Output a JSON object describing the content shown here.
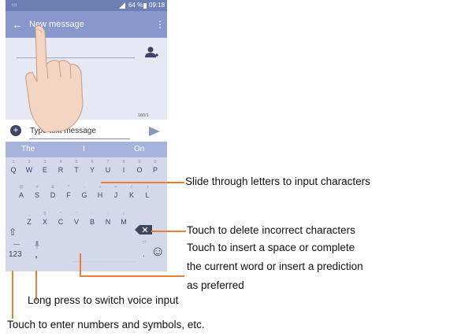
{
  "status_bar": {
    "left": "▭",
    "battery": "64 %",
    "time": "09:18"
  },
  "app_bar": {
    "back": "←",
    "title": "New message",
    "more": "⋮"
  },
  "compose": {
    "counter": "160/1",
    "plus": "+",
    "placeholder": "Type text message"
  },
  "suggestions": [
    "The",
    "I",
    "On"
  ],
  "keyboard": {
    "row1": [
      {
        "main": "Q",
        "sub": "1"
      },
      {
        "main": "W",
        "sub": "2"
      },
      {
        "main": "E",
        "sub": "3"
      },
      {
        "main": "R",
        "sub": "4"
      },
      {
        "main": "T",
        "sub": "5"
      },
      {
        "main": "Y",
        "sub": "6"
      },
      {
        "main": "U",
        "sub": "7"
      },
      {
        "main": "I",
        "sub": "8"
      },
      {
        "main": "O",
        "sub": "9"
      },
      {
        "main": "P",
        "sub": "0"
      }
    ],
    "row2": [
      {
        "main": "A",
        "sub": "@"
      },
      {
        "main": "S",
        "sub": "#"
      },
      {
        "main": "D",
        "sub": "&"
      },
      {
        "main": "F",
        "sub": "*"
      },
      {
        "main": "G",
        "sub": "-"
      },
      {
        "main": "H",
        "sub": "+"
      },
      {
        "main": "J",
        "sub": "="
      },
      {
        "main": "K",
        "sub": "("
      },
      {
        "main": "L",
        "sub": ")"
      }
    ],
    "row3": [
      {
        "main": "Z",
        "sub": "_"
      },
      {
        "main": "X",
        "sub": "$"
      },
      {
        "main": "C",
        "sub": "\""
      },
      {
        "main": "V",
        "sub": "'"
      },
      {
        "main": "B",
        "sub": ":"
      },
      {
        "main": "N",
        "sub": ";"
      },
      {
        "main": "M",
        "sub": "/"
      }
    ],
    "shift": "⇧",
    "numbers": "123",
    "comma": ",",
    "period": ".",
    "period_sub": "!?",
    "emoji": "☺"
  },
  "callouts": {
    "slide": "Slide through letters to input characters",
    "delete": "Touch to delete incorrect characters",
    "space_1": "Touch to insert a space or complete",
    "space_2": "the current word or insert a prediction",
    "space_3": "as preferred",
    "voice": "Long press to switch voice input",
    "numbers": "Touch to enter numbers and symbols, etc."
  },
  "colors": {
    "accent": "#e87e3a",
    "appbar": "#8898cc",
    "suggestion_bar": "#a7b3db"
  }
}
